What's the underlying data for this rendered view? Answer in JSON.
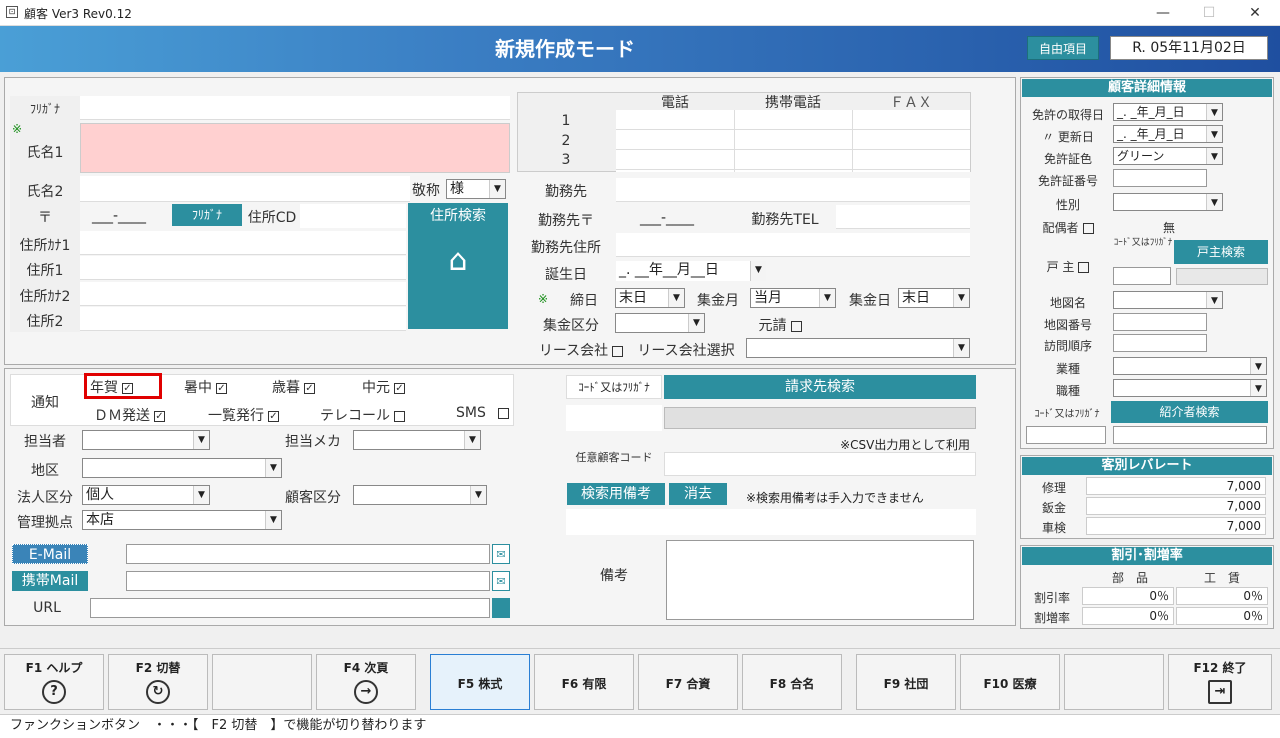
{
  "window": {
    "title": "顧客 Ver3 Rev0.12",
    "min": "—",
    "max": "☐",
    "close": "✕"
  },
  "header": {
    "mode": "新規作成モード",
    "free_item": "自由項目",
    "date": "R. 05年11月02日"
  },
  "left": {
    "furigana": "ﾌﾘｶﾞﾅ",
    "note_mark": "※",
    "name1": "氏名1",
    "name2": "氏名2",
    "keisho": "敬称",
    "keisho_val": "様",
    "zip": "〒",
    "zip_val": "___-____",
    "furigana_btn": "ﾌﾘｶﾞﾅ",
    "addr_cd": "住所CD",
    "addr_search": "住所検索",
    "addr_kana1": "住所ｶﾅ1",
    "addr1": "住所1",
    "addr_kana2": "住所ｶﾅ2",
    "addr2": "住所2"
  },
  "phone": {
    "col_tel": "電話",
    "col_mobile": "携帯電話",
    "col_fax": "ＦＡＸ",
    "rows": [
      "1",
      "2",
      "3"
    ]
  },
  "work": {
    "company": "勤務先",
    "zip": "勤務先〒",
    "zip_val": "___-____",
    "tel": "勤務先TEL",
    "address": "勤務先住所",
    "birthday": "誕生日",
    "birthday_val": "_. __年__月__日",
    "shime_mark": "※",
    "shime": "締日",
    "shime_val": "末日",
    "shukin_month": "集金月",
    "shukin_month_val": "当月",
    "shukin_day": "集金日",
    "shukin_day_val": "末日",
    "shukin_kubun": "集金区分",
    "genseikyu": "元請",
    "lease": "リース会社",
    "lease_select": "リース会社選択"
  },
  "notify": {
    "label": "通知",
    "nenga": "年賀",
    "shochu": "暑中",
    "seibo": "歳暮",
    "chugen": "中元",
    "dm": "ＤＭ発送",
    "ichiran": "一覧発行",
    "telecall": "テレコール",
    "sms": "SMS",
    "checked": "✓"
  },
  "staff": {
    "tanto": "担当者",
    "tanto_maker": "担当メカ",
    "chiku": "地区",
    "hojin": "法人区分",
    "hojin_val": "個人",
    "kokyaku": "顧客区分",
    "kanri": "管理拠点",
    "kanri_val": "本店"
  },
  "mail": {
    "email": "E-Mail",
    "mobile_mail": "携帯Mail",
    "url": "URL",
    "mail_icon": "✉"
  },
  "billing": {
    "code_label": "ｺｰﾄﾞ又はﾌﾘｶﾞﾅ",
    "search": "請求先検索",
    "csv_note": "※CSV出力用として利用",
    "nin_code": "任意顧客コード",
    "bikou_search": "検索用備考",
    "delete": "消去",
    "bikou_note": "※検索用備考は手入力できません",
    "bikou": "備考"
  },
  "detail": {
    "title": "顧客詳細情報",
    "license_date": "免許の取得日",
    "license_date_val": "_. _年_月_日",
    "renew": "〃 更新日",
    "renew_val": "_. _年_月_日",
    "license_color": "免許証色",
    "license_color_val": "グリーン",
    "license_no": "免許証番号",
    "gender": "性別",
    "spouse": "配偶者",
    "spouse_val": "無",
    "kocho": "戸 主",
    "code_kana": "ｺｰﾄﾞ又はﾌﾘｶﾞﾅ",
    "kocho_search": "戸主検索",
    "map_name": "地図名",
    "map_no": "地図番号",
    "visit": "訪問順序",
    "industry": "業種",
    "job": "職種",
    "code_kana2": "ｺｰﾄﾞ又はﾌﾘｶﾞﾅ",
    "introducer": "紹介者検索"
  },
  "rate": {
    "title": "客別レバレート",
    "rows": [
      {
        "name": "修理",
        "val": "7,000"
      },
      {
        "name": "鈑金",
        "val": "7,000"
      },
      {
        "name": "車検",
        "val": "7,000"
      }
    ]
  },
  "discount": {
    "title": "割引･割増率",
    "col_parts": "部　品",
    "col_labor": "工　賃",
    "rows": [
      {
        "name": "割引率",
        "parts": "0％",
        "labor": "0％"
      },
      {
        "name": "割増率",
        "parts": "0％",
        "labor": "0％"
      }
    ]
  },
  "fkeys": [
    {
      "label": "F1 ヘルプ",
      "icon": "?"
    },
    {
      "label": "F2 切替",
      "icon": "↻"
    },
    {
      "label": "",
      "icon": ""
    },
    {
      "label": "F4 次頁",
      "icon": "→"
    },
    {
      "label": "F5 株式",
      "icon": ""
    },
    {
      "label": "F6 有限",
      "icon": ""
    },
    {
      "label": "F7 合資",
      "icon": ""
    },
    {
      "label": "F8 合名",
      "icon": ""
    },
    {
      "label": "F9 社団",
      "icon": ""
    },
    {
      "label": "F10 医療",
      "icon": ""
    },
    {
      "label": "",
      "icon": ""
    },
    {
      "label": "F12 終了",
      "icon": "⇥"
    }
  ],
  "status": "ファンクションボタン　・・・【　F2 切替　】で機能が切り替わります"
}
